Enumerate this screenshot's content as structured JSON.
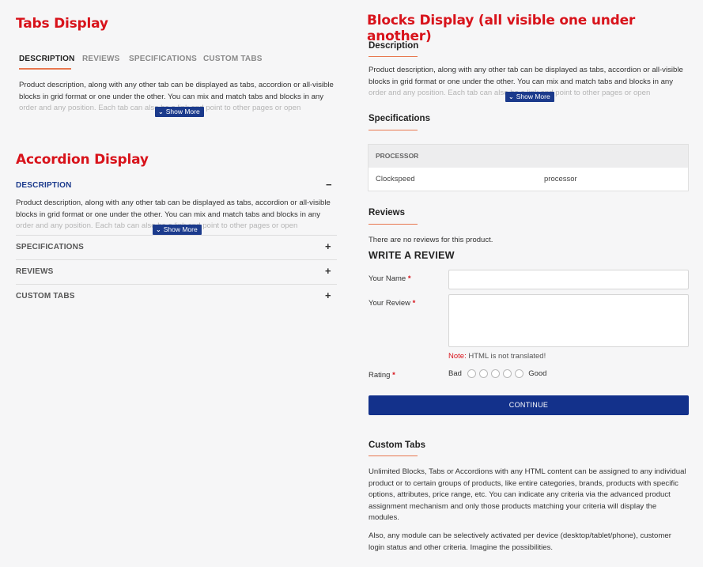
{
  "tabs_section": {
    "title": "Tabs Display",
    "tabs": [
      {
        "label": "DESCRIPTION"
      },
      {
        "label": "REVIEWS"
      },
      {
        "label": "SPECIFICATIONS"
      },
      {
        "label": "CUSTOM TABS"
      }
    ],
    "description_lines": [
      "Product description, along with any other tab can be displayed as tabs, accordion or all-visible",
      "blocks in grid format or one under the other.  You can mix and match tabs and blocks in any",
      "order and any position. Each tab can also be a link and point to other pages or open"
    ],
    "show_more": "Show More"
  },
  "accordion_section": {
    "title": "Accordion Display",
    "items": [
      {
        "label": "DESCRIPTION",
        "sign": "−"
      },
      {
        "label": "SPECIFICATIONS",
        "sign": "+"
      },
      {
        "label": "REVIEWS",
        "sign": "+"
      },
      {
        "label": "CUSTOM TABS",
        "sign": "+"
      }
    ],
    "description_lines": [
      "Product description, along with any other tab can be displayed as tabs, accordion or all-visible",
      "blocks in grid format or one under the other.  You can mix and match tabs and blocks in any",
      "order and any position. Each tab can also be a link and point to other pages or open"
    ],
    "show_more": "Show More"
  },
  "blocks_section": {
    "title": "Blocks Display (all visible one under another)",
    "description": {
      "title": "Description",
      "lines": [
        "Product description, along with any other tab can be displayed as tabs, accordion or all-visible",
        "blocks in grid format or one under the other.  You can mix and match tabs and blocks in any",
        "order and any position. Each tab can also be a link and point to other pages or open"
      ],
      "show_more": "Show More"
    },
    "specifications": {
      "title": "Specifications",
      "group": "PROCESSOR",
      "row_name": "Clockspeed",
      "row_value": "processor"
    },
    "reviews": {
      "title": "Reviews",
      "no_reviews": "There are no reviews for this product.",
      "write_review": "WRITE A REVIEW",
      "name_label": "Your Name",
      "review_label": "Your Review",
      "required_mark": "*",
      "note_label": "Note:",
      "note_text": "HTML is not translated!",
      "rating_label": "Rating",
      "rating_bad": "Bad",
      "rating_good": "Good",
      "continue": "CONTINUE"
    },
    "custom_tabs": {
      "title": "Custom Tabs",
      "para1_lines": [
        "Unlimited Blocks, Tabs or Accordions with any HTML content can be assigned to any individual",
        "product or to certain groups of products, like entire categories, brands, products with specific",
        "options, attributes, price range, etc. You can indicate any criteria via the advanced product",
        "assignment mechanism and only those products matching your criteria will display the",
        "modules."
      ],
      "para2_lines": [
        "Also, any module can be selectively activated per device (desktop/tablet/phone), customer",
        "login status and other criteria. Imagine the possibilities."
      ]
    }
  },
  "colors": {
    "title_red": "#d8131b",
    "accent_orange": "#e8774f",
    "brand_blue": "#13318b"
  }
}
